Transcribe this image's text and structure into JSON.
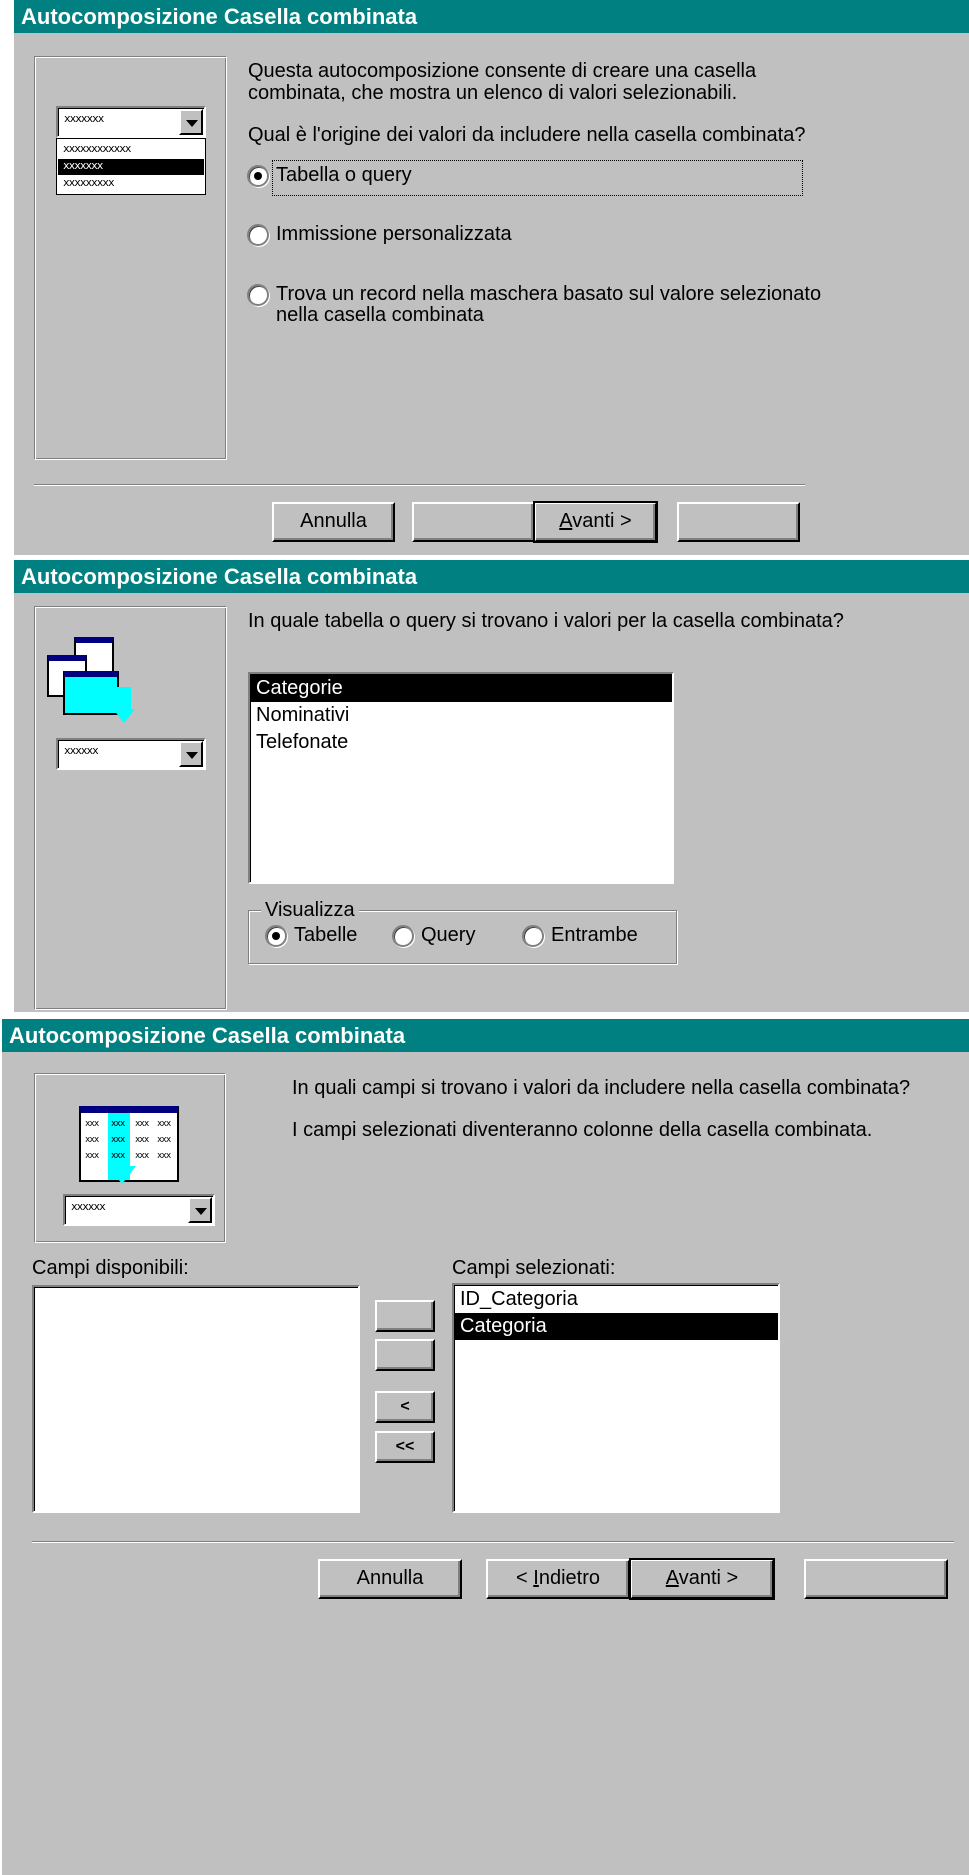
{
  "dialog1": {
    "title": "Autocomposizione Casella combinata",
    "intro_line1": "Questa autocomposizione consente di creare una casella",
    "intro_line2": "combinata, che mostra un elenco di valori selezionabili.",
    "question": "Qual è l'origine dei valori da includere nella casella combinata?",
    "illus_combo_text": "xxxxxxx",
    "illus_list_items": [
      "xxxxxxxxxxxx",
      "xxxxxxx",
      "xxxxxxxxx"
    ],
    "options": [
      {
        "label": "Tabella o query",
        "selected": true
      },
      {
        "label": "Immissione personalizzata",
        "selected": false
      },
      {
        "label_line1": "Trova un record nella maschera basato sul valore selezionato",
        "label_line2": "nella casella combinata",
        "selected": false
      }
    ],
    "buttons": {
      "cancel": "Annulla",
      "back": "",
      "next_accel": "A",
      "next_rest": "vanti >",
      "finish": ""
    }
  },
  "dialog2": {
    "title": "Autocomposizione Casella combinata",
    "question": "In quale tabella o query si trovano i valori per la casella combinata?",
    "illus_combo_text": "xxxxxx",
    "tables": [
      {
        "name": "Categorie",
        "selected": true
      },
      {
        "name": "Nominativi",
        "selected": false
      },
      {
        "name": "Telefonate",
        "selected": false
      }
    ],
    "view_group": {
      "label": "Visualizza",
      "options": [
        {
          "label": "Tabelle",
          "selected": true
        },
        {
          "label": "Query",
          "selected": false
        },
        {
          "label": "Entrambe",
          "selected": false
        }
      ]
    }
  },
  "dialog3": {
    "title": "Autocomposizione Casella combinata",
    "question": "In quali campi si trovano i valori da includere nella casella combinata?",
    "note": "I campi selezionati diventeranno colonne della casella combinata.",
    "illus_combo_text": "xxxxxx",
    "illus_grid_cell": "xxx",
    "available_label": "Campi disponibili:",
    "selected_label": "Campi selezionati:",
    "available_fields": [],
    "selected_fields": [
      {
        "name": "ID_Categoria",
        "selected": false
      },
      {
        "name": "Categoria",
        "selected": true
      }
    ],
    "move_buttons": {
      "add_one": "",
      "add_all": "",
      "remove_one": "<",
      "remove_all": "<<"
    },
    "buttons": {
      "cancel": "Annulla",
      "back_prefix": "< ",
      "back_accel": "I",
      "back_rest": "ndietro",
      "next_accel": "A",
      "next_rest": "vanti >",
      "finish": ""
    }
  }
}
